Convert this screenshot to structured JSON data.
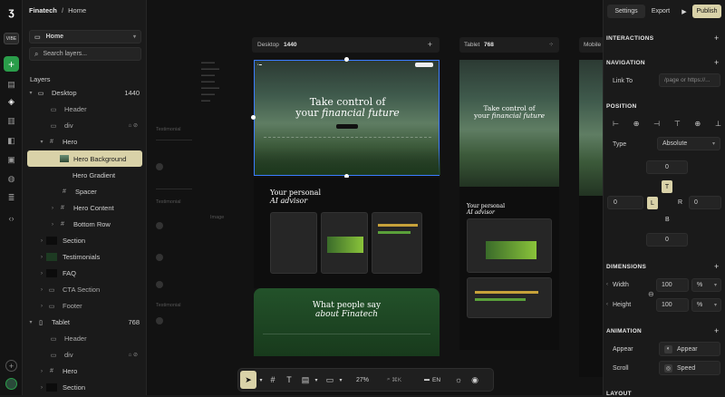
{
  "app": {
    "project": "Finatech",
    "breadcrumb_sep": "/",
    "page": "Home",
    "badge": "VIBE"
  },
  "layers_panel": {
    "page_select": "Home",
    "search_placeholder": "Search layers...",
    "title": "Layers",
    "desktop_label": "Desktop",
    "desktop_width": "1440",
    "tablet_label": "Tablet",
    "tablet_width": "768",
    "items": [
      "Header",
      "div",
      "Hero",
      "Hero Background",
      "Hero Gradient",
      "Spacer",
      "Hero Content",
      "Bottom Row",
      "Section",
      "Testimonials",
      "FAQ",
      "CTA Section",
      "Footer"
    ],
    "tablet_items": [
      "Header",
      "div",
      "Hero",
      "Section"
    ]
  },
  "topbar": {
    "settings": "Settings",
    "export": "Export",
    "publish": "Publish"
  },
  "canvas": {
    "desktop_frame": "Desktop",
    "desktop_w": "1440",
    "tablet_frame": "Tablet",
    "tablet_w": "768",
    "mobile_frame": "Mobile",
    "hero_title_1": "Take control of",
    "hero_title_2": "your",
    "hero_title_3": "financial future",
    "advisor_1": "Your personal",
    "advisor_2": "AI advisor",
    "say_1": "What people say",
    "say_2": "about Finatech",
    "side_testimonial": "Testimonial",
    "side_image": "Image",
    "tablet_advisor_1": "Your personal",
    "tablet_advisor_2": "AI advisor"
  },
  "toolbar": {
    "zoom": "27%",
    "search": "⌘K",
    "lang": "EN"
  },
  "props": {
    "interactions": "INTERACTIONS",
    "navigation": "NAVIGATION",
    "link_to": "Link To",
    "link_placeholder": "/page or https://...",
    "position": "POSITION",
    "type_label": "Type",
    "type_value": "Absolute",
    "pos_top": "0",
    "pos_left": "0",
    "pos_right": "0",
    "pos_bottom": "0",
    "T": "T",
    "L": "L",
    "R": "R",
    "B": "B",
    "dimensions": "DIMENSIONS",
    "width_label": "Width",
    "width_value": "100",
    "width_unit": "%",
    "height_label": "Height",
    "height_value": "100",
    "height_unit": "%",
    "animation": "ANIMATION",
    "appear_label": "Appear",
    "appear_value": "Appear",
    "scroll_label": "Scroll",
    "scroll_value": "Speed",
    "layout": "LAYOUT"
  },
  "colors": {
    "accent": "#d9d2a8",
    "selection": "#3b7cff",
    "green": "#2a9d4a"
  }
}
